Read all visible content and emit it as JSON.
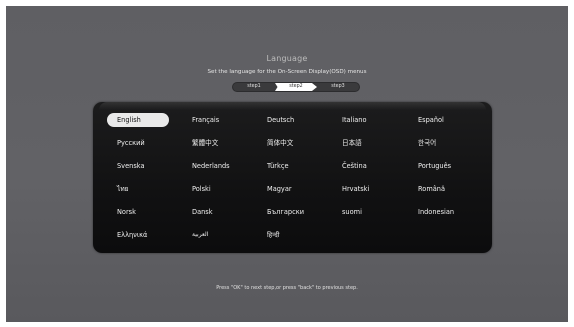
{
  "header": {
    "title": "Language",
    "subtitle": "Set the language for the On-Screen Display(OSD) menus"
  },
  "steps": [
    {
      "label": "step1",
      "active": false
    },
    {
      "label": "step2",
      "active": true
    },
    {
      "label": "step3",
      "active": false
    }
  ],
  "languages": {
    "selected": "English",
    "rows": [
      [
        "English",
        "Français",
        "Deutsch",
        "Italiano",
        "Español"
      ],
      [
        "Русский",
        "繁體中文",
        "简体中文",
        "日本語",
        "한국어"
      ],
      [
        "Svenska",
        "Nederlands",
        "Türkçe",
        "Čeština",
        "Português"
      ],
      [
        "ไทย",
        "Polski",
        "Magyar",
        "Hrvatski",
        "Română"
      ],
      [
        "Norsk",
        "Dansk",
        "Български",
        "suomi",
        "Indonesian"
      ],
      [
        "Ελληνικά",
        "العربية",
        "हिन्दी"
      ]
    ]
  },
  "footer": {
    "hint": "Press \"OK\" to next step,or press \"back\" to previous step."
  },
  "colors": {
    "background": "#606064",
    "panel": "#141415",
    "selected_bg": "#e9e9e9",
    "text": "#f0f0f0"
  }
}
